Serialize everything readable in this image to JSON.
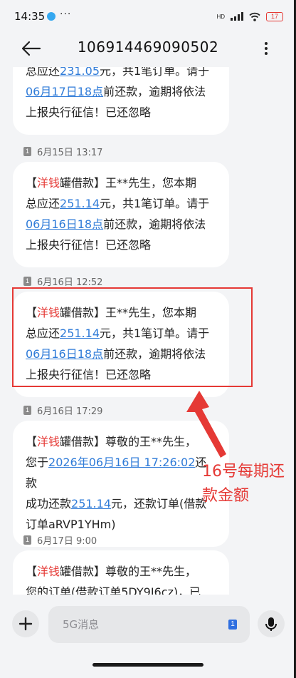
{
  "status_bar": {
    "time": "14:35",
    "more": "···",
    "network": "HD",
    "battery": "17"
  },
  "header": {
    "title": "106914469090502"
  },
  "messages": [
    {
      "timestamp": "",
      "lines": [
        {
          "parts": [
            {
              "t": "总应还",
              "s": "n"
            },
            {
              "t": "231.05",
              "s": "l"
            },
            {
              "t": "元，共1笔订单。请于",
              "s": "n"
            }
          ]
        },
        {
          "parts": [
            {
              "t": "06月17日18点",
              "s": "l"
            },
            {
              "t": "前还款，逾期将依法",
              "s": "n"
            }
          ]
        },
        {
          "parts": [
            {
              "t": "上报央行征信！已还忽略",
              "s": "n"
            }
          ]
        }
      ]
    },
    {
      "sim": "1",
      "timestamp": "6月15日 13:17",
      "lines": [
        {
          "parts": [
            {
              "t": "【",
              "s": "n"
            },
            {
              "t": "洋钱",
              "s": "r"
            },
            {
              "t": "罐借款】王**先生，您本期",
              "s": "n"
            }
          ]
        },
        {
          "parts": [
            {
              "t": "总应还",
              "s": "n"
            },
            {
              "t": "251.14",
              "s": "l"
            },
            {
              "t": "元，共1笔订单。请于",
              "s": "n"
            }
          ]
        },
        {
          "parts": [
            {
              "t": "06月16日18点",
              "s": "l"
            },
            {
              "t": "前还款，逾期将依法",
              "s": "n"
            }
          ]
        },
        {
          "parts": [
            {
              "t": "上报央行征信！已还忽略",
              "s": "n"
            }
          ]
        }
      ]
    },
    {
      "sim": "1",
      "timestamp": "6月16日 12:52",
      "lines": [
        {
          "parts": [
            {
              "t": "【",
              "s": "n"
            },
            {
              "t": "洋钱",
              "s": "r"
            },
            {
              "t": "罐借款】王**先生，您本期",
              "s": "n"
            }
          ]
        },
        {
          "parts": [
            {
              "t": "总应还",
              "s": "n"
            },
            {
              "t": "251.14",
              "s": "l"
            },
            {
              "t": "元，共1笔订单。请于",
              "s": "n"
            }
          ]
        },
        {
          "parts": [
            {
              "t": "06月16日18点",
              "s": "l"
            },
            {
              "t": "前还款，逾期将依法",
              "s": "n"
            }
          ]
        },
        {
          "parts": [
            {
              "t": "上报央行征信！已还忽略",
              "s": "n"
            }
          ]
        }
      ]
    },
    {
      "sim": "1",
      "timestamp": "6月16日 17:29",
      "lines": [
        {
          "parts": [
            {
              "t": "【",
              "s": "n"
            },
            {
              "t": "洋钱",
              "s": "r"
            },
            {
              "t": "罐借款】尊敬的王**先生，",
              "s": "n"
            }
          ]
        },
        {
          "parts": [
            {
              "t": "您于",
              "s": "n"
            },
            {
              "t": "2026年06月16日 17:26:02",
              "s": "l"
            },
            {
              "t": "还款",
              "s": "n"
            }
          ]
        },
        {
          "parts": [
            {
              "t": "成功还款",
              "s": "n"
            },
            {
              "t": "251.14",
              "s": "l"
            },
            {
              "t": "元，还款订单(借款",
              "s": "n"
            }
          ]
        },
        {
          "parts": [
            {
              "t": "订单aRVP1YHm)",
              "s": "n"
            }
          ]
        }
      ]
    },
    {
      "sim": "1",
      "timestamp": "6月17日 9:00",
      "lines": [
        {
          "parts": [
            {
              "t": "【",
              "s": "n"
            },
            {
              "t": "洋钱",
              "s": "r"
            },
            {
              "t": "罐借款】尊敬的王**先生，",
              "s": "n"
            }
          ]
        },
        {
          "parts": [
            {
              "t": "您的订单(借款订单5DY9J6cz)，已",
              "s": "n"
            }
          ]
        }
      ]
    }
  ],
  "annotation": {
    "text_line1": "16号每期还",
    "text_line2": "款金额"
  },
  "composer": {
    "placeholder": "5G消息",
    "sim": "1"
  },
  "colors": {
    "link": "#2f7bd8",
    "brand_red": "#e53935",
    "background": "#f3f4f6",
    "bubble": "#ffffff"
  }
}
